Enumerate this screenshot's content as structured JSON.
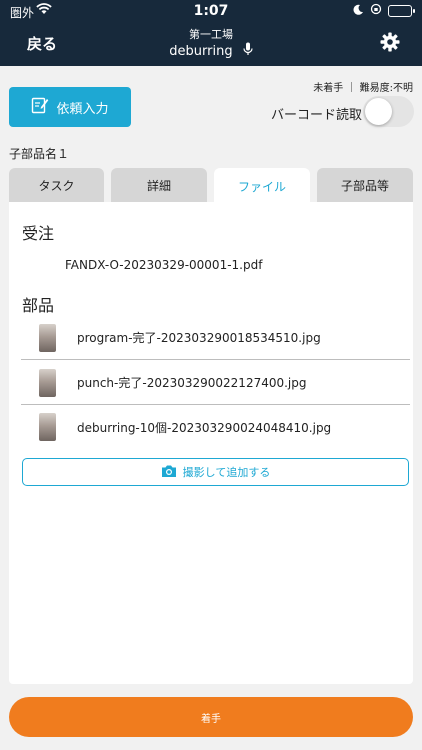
{
  "status_bar": {
    "carrier": "圏外",
    "time": "1:07"
  },
  "nav": {
    "back_label": "戻る",
    "title": "第一工場",
    "subtitle": "deburring"
  },
  "meta": {
    "status_text": "未着手 ｜ 難易度:不明"
  },
  "request_button": {
    "label": "依頼入力"
  },
  "barcode": {
    "label": "バーコード読取",
    "enabled": false
  },
  "part_name": "子部品名１",
  "tabs": [
    {
      "label": "タスク",
      "active": false
    },
    {
      "label": "詳細",
      "active": false
    },
    {
      "label": "ファイル",
      "active": true
    },
    {
      "label": "子部品等",
      "active": false
    }
  ],
  "sections": {
    "order_title": "受注",
    "order_files": [
      "FANDX-O-20230329-00001-1.pdf"
    ],
    "parts_title": "部品",
    "part_files": [
      "program-完了-202303290018534510.jpg",
      "punch-完了-202303290022127400.jpg",
      "deburring-10個-202303290024048410.jpg"
    ]
  },
  "photo_button": {
    "label": "撮影して追加する"
  },
  "start_button": {
    "label": "着手"
  },
  "colors": {
    "nav_bg": "#17293b",
    "accent": "#1ea8d3",
    "start": "#f07c1e"
  }
}
